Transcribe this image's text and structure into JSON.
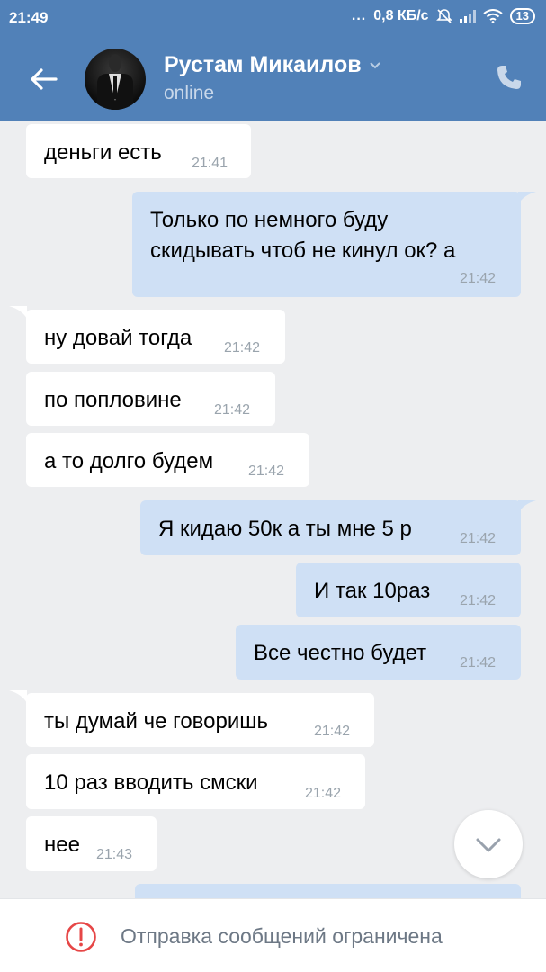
{
  "status_bar": {
    "time": "21:49",
    "dots": "...",
    "network_speed": "0,8 КБ/с",
    "battery": "13"
  },
  "header": {
    "name": "Рустам Микаилов",
    "presence": "online"
  },
  "messages": [
    {
      "side": "in",
      "text": "деньги есть",
      "time": "21:41"
    },
    {
      "side": "out",
      "text": "Только по немного буду",
      "text2": "скидывать чтоб не кинул ок? а",
      "time": "21:42"
    },
    {
      "side": "in",
      "text": "ну довай тогда",
      "time": "21:42"
    },
    {
      "side": "in",
      "text": "по попловине",
      "time": "21:42"
    },
    {
      "side": "in",
      "text": "а то долго будем",
      "time": "21:42"
    },
    {
      "side": "out",
      "text": "Я кидаю 50к а ты мне 5 р",
      "time": "21:42"
    },
    {
      "side": "out",
      "text": "И так 10раз",
      "time": "21:42"
    },
    {
      "side": "out",
      "text": "Все честно будет",
      "time": "21:42"
    },
    {
      "side": "in",
      "text": "ты думай че говоришь",
      "time": "21:42"
    },
    {
      "side": "in",
      "text": "10 раз вводить смски",
      "time": "21:42"
    },
    {
      "side": "in",
      "text": "нее",
      "time": "21:43"
    }
  ],
  "bottom": {
    "restriction_text": "Отправка сообщений ограничена"
  },
  "colors": {
    "header_bg": "#5181b8",
    "chat_bg": "#edeef0",
    "outgoing_bubble": "#cfe0f5",
    "incoming_bubble": "#ffffff",
    "warning": "#e64646"
  }
}
